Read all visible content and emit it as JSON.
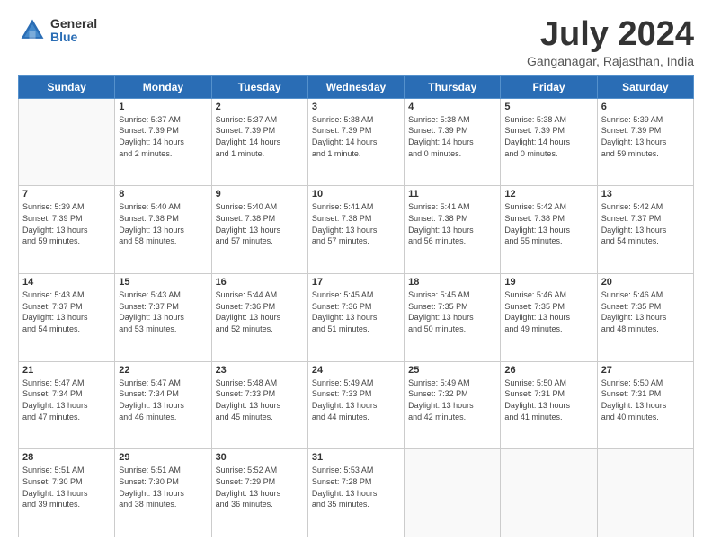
{
  "header": {
    "logo_general": "General",
    "logo_blue": "Blue",
    "month_title": "July 2024",
    "location": "Ganganagar, Rajasthan, India"
  },
  "weekdays": [
    "Sunday",
    "Monday",
    "Tuesday",
    "Wednesday",
    "Thursday",
    "Friday",
    "Saturday"
  ],
  "weeks": [
    [
      {
        "day": "",
        "info": ""
      },
      {
        "day": "1",
        "info": "Sunrise: 5:37 AM\nSunset: 7:39 PM\nDaylight: 14 hours\nand 2 minutes."
      },
      {
        "day": "2",
        "info": "Sunrise: 5:37 AM\nSunset: 7:39 PM\nDaylight: 14 hours\nand 1 minute."
      },
      {
        "day": "3",
        "info": "Sunrise: 5:38 AM\nSunset: 7:39 PM\nDaylight: 14 hours\nand 1 minute."
      },
      {
        "day": "4",
        "info": "Sunrise: 5:38 AM\nSunset: 7:39 PM\nDaylight: 14 hours\nand 0 minutes."
      },
      {
        "day": "5",
        "info": "Sunrise: 5:38 AM\nSunset: 7:39 PM\nDaylight: 14 hours\nand 0 minutes."
      },
      {
        "day": "6",
        "info": "Sunrise: 5:39 AM\nSunset: 7:39 PM\nDaylight: 13 hours\nand 59 minutes."
      }
    ],
    [
      {
        "day": "7",
        "info": "Sunrise: 5:39 AM\nSunset: 7:39 PM\nDaylight: 13 hours\nand 59 minutes."
      },
      {
        "day": "8",
        "info": "Sunrise: 5:40 AM\nSunset: 7:38 PM\nDaylight: 13 hours\nand 58 minutes."
      },
      {
        "day": "9",
        "info": "Sunrise: 5:40 AM\nSunset: 7:38 PM\nDaylight: 13 hours\nand 57 minutes."
      },
      {
        "day": "10",
        "info": "Sunrise: 5:41 AM\nSunset: 7:38 PM\nDaylight: 13 hours\nand 57 minutes."
      },
      {
        "day": "11",
        "info": "Sunrise: 5:41 AM\nSunset: 7:38 PM\nDaylight: 13 hours\nand 56 minutes."
      },
      {
        "day": "12",
        "info": "Sunrise: 5:42 AM\nSunset: 7:38 PM\nDaylight: 13 hours\nand 55 minutes."
      },
      {
        "day": "13",
        "info": "Sunrise: 5:42 AM\nSunset: 7:37 PM\nDaylight: 13 hours\nand 54 minutes."
      }
    ],
    [
      {
        "day": "14",
        "info": "Sunrise: 5:43 AM\nSunset: 7:37 PM\nDaylight: 13 hours\nand 54 minutes."
      },
      {
        "day": "15",
        "info": "Sunrise: 5:43 AM\nSunset: 7:37 PM\nDaylight: 13 hours\nand 53 minutes."
      },
      {
        "day": "16",
        "info": "Sunrise: 5:44 AM\nSunset: 7:36 PM\nDaylight: 13 hours\nand 52 minutes."
      },
      {
        "day": "17",
        "info": "Sunrise: 5:45 AM\nSunset: 7:36 PM\nDaylight: 13 hours\nand 51 minutes."
      },
      {
        "day": "18",
        "info": "Sunrise: 5:45 AM\nSunset: 7:35 PM\nDaylight: 13 hours\nand 50 minutes."
      },
      {
        "day": "19",
        "info": "Sunrise: 5:46 AM\nSunset: 7:35 PM\nDaylight: 13 hours\nand 49 minutes."
      },
      {
        "day": "20",
        "info": "Sunrise: 5:46 AM\nSunset: 7:35 PM\nDaylight: 13 hours\nand 48 minutes."
      }
    ],
    [
      {
        "day": "21",
        "info": "Sunrise: 5:47 AM\nSunset: 7:34 PM\nDaylight: 13 hours\nand 47 minutes."
      },
      {
        "day": "22",
        "info": "Sunrise: 5:47 AM\nSunset: 7:34 PM\nDaylight: 13 hours\nand 46 minutes."
      },
      {
        "day": "23",
        "info": "Sunrise: 5:48 AM\nSunset: 7:33 PM\nDaylight: 13 hours\nand 45 minutes."
      },
      {
        "day": "24",
        "info": "Sunrise: 5:49 AM\nSunset: 7:33 PM\nDaylight: 13 hours\nand 44 minutes."
      },
      {
        "day": "25",
        "info": "Sunrise: 5:49 AM\nSunset: 7:32 PM\nDaylight: 13 hours\nand 42 minutes."
      },
      {
        "day": "26",
        "info": "Sunrise: 5:50 AM\nSunset: 7:31 PM\nDaylight: 13 hours\nand 41 minutes."
      },
      {
        "day": "27",
        "info": "Sunrise: 5:50 AM\nSunset: 7:31 PM\nDaylight: 13 hours\nand 40 minutes."
      }
    ],
    [
      {
        "day": "28",
        "info": "Sunrise: 5:51 AM\nSunset: 7:30 PM\nDaylight: 13 hours\nand 39 minutes."
      },
      {
        "day": "29",
        "info": "Sunrise: 5:51 AM\nSunset: 7:30 PM\nDaylight: 13 hours\nand 38 minutes."
      },
      {
        "day": "30",
        "info": "Sunrise: 5:52 AM\nSunset: 7:29 PM\nDaylight: 13 hours\nand 36 minutes."
      },
      {
        "day": "31",
        "info": "Sunrise: 5:53 AM\nSunset: 7:28 PM\nDaylight: 13 hours\nand 35 minutes."
      },
      {
        "day": "",
        "info": ""
      },
      {
        "day": "",
        "info": ""
      },
      {
        "day": "",
        "info": ""
      }
    ]
  ]
}
